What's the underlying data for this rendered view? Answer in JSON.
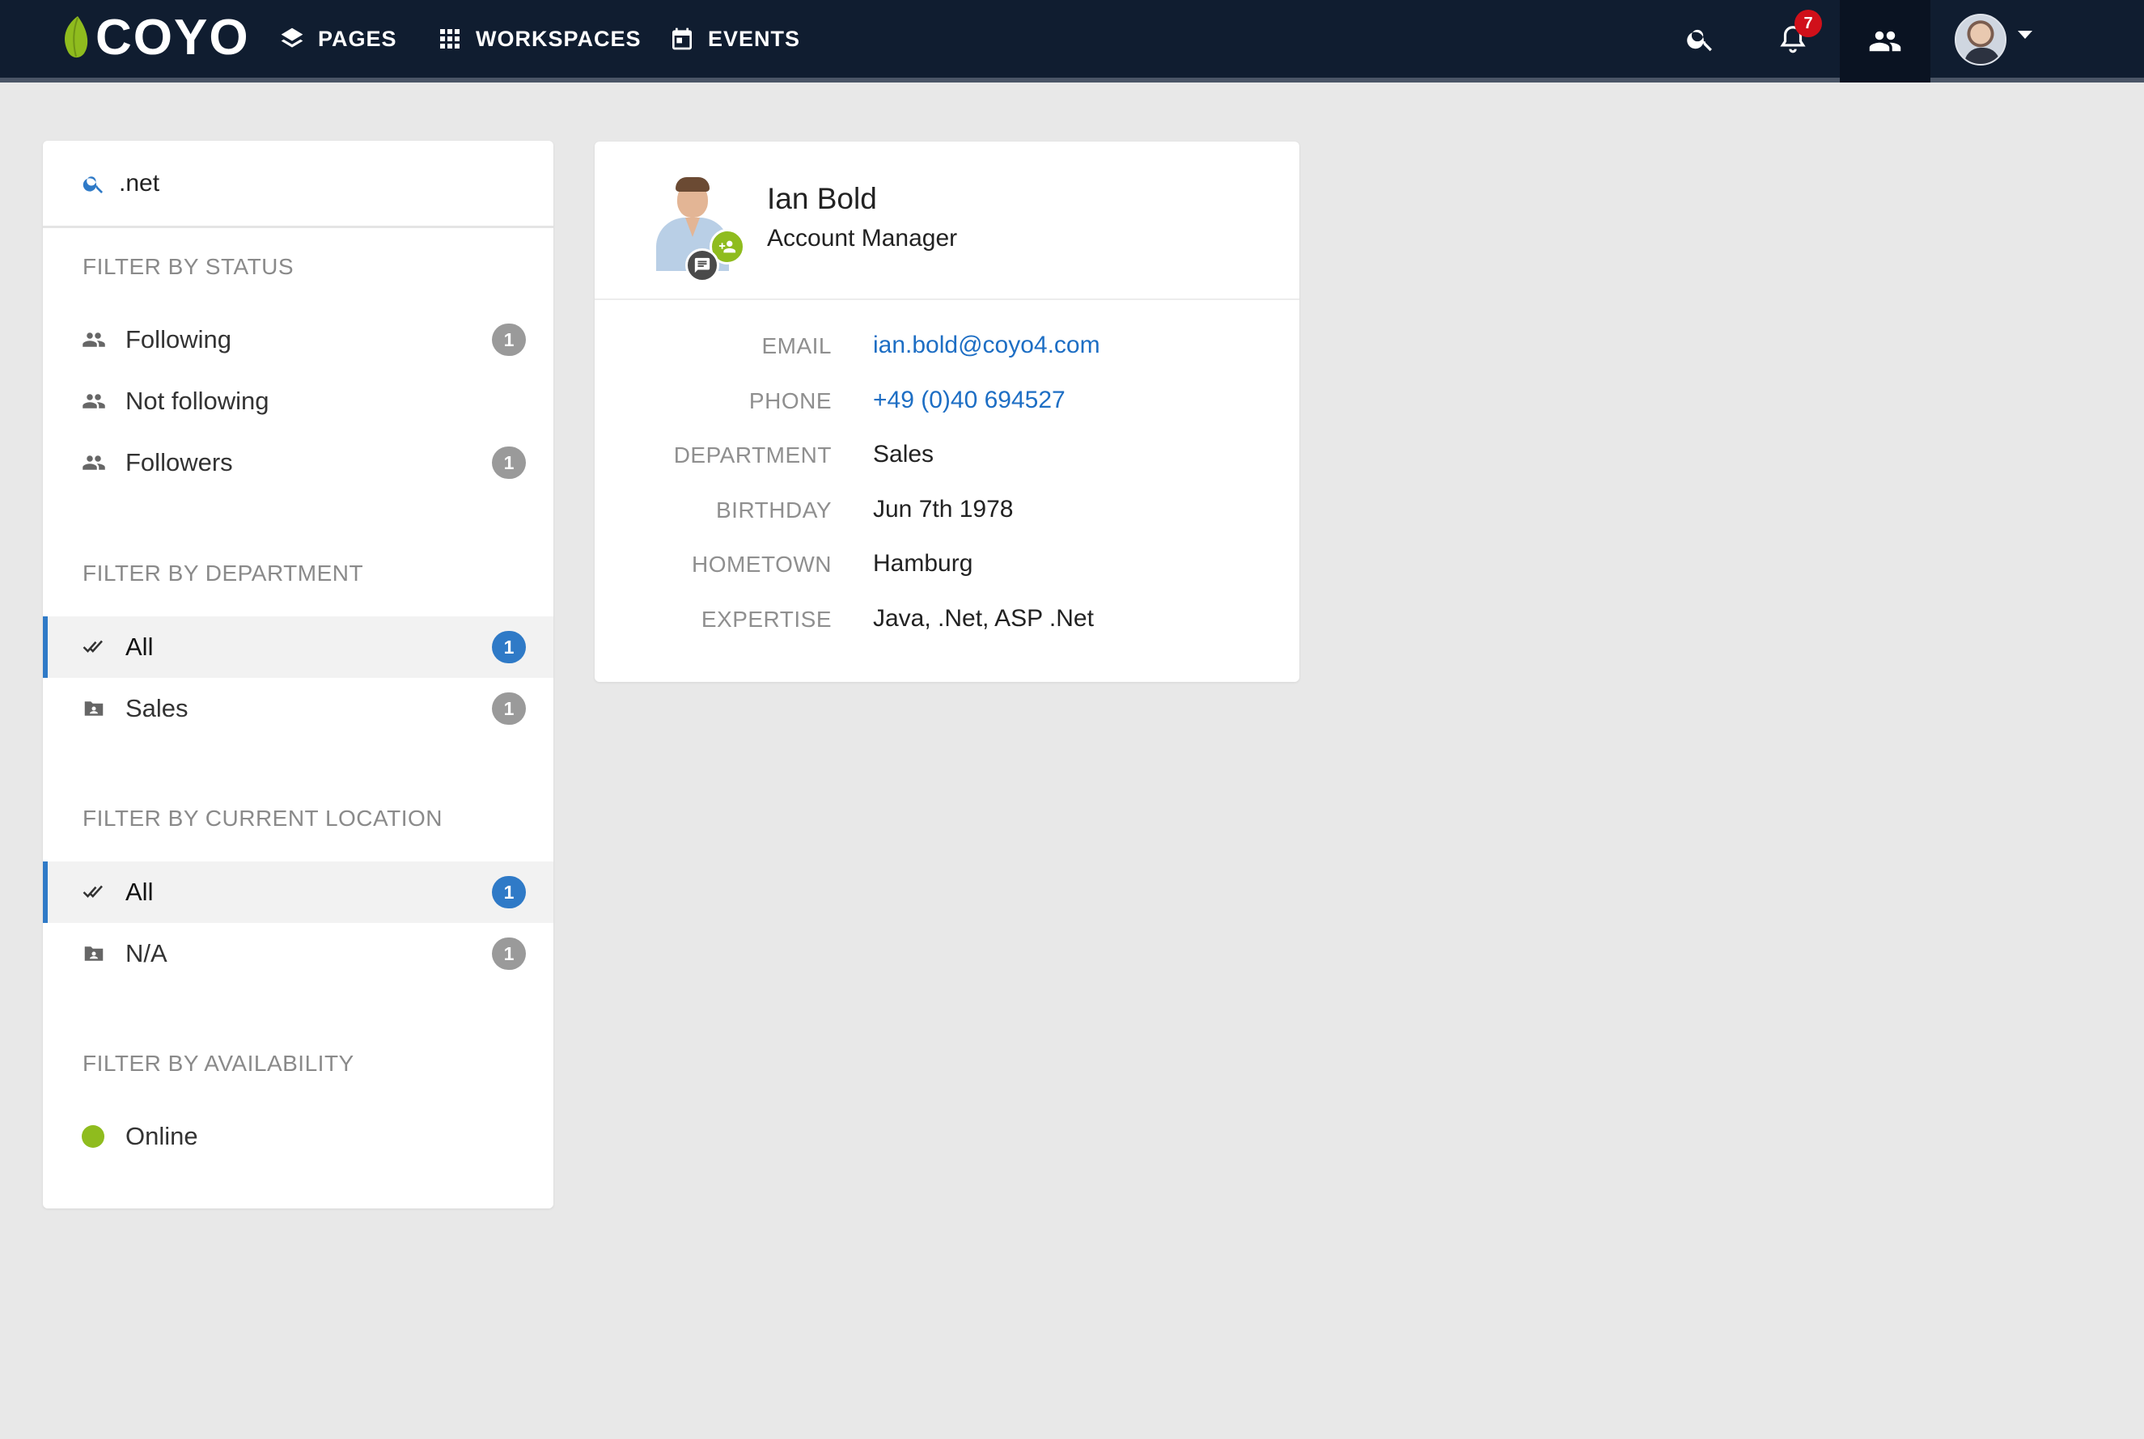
{
  "navbar": {
    "logo_text": "COYO",
    "items": [
      {
        "label": "PAGES",
        "icon": "layers-icon"
      },
      {
        "label": "WORKSPACES",
        "icon": "grid-icon"
      },
      {
        "label": "EVENTS",
        "icon": "calendar-icon"
      }
    ],
    "notifications_count": "7",
    "colors": {
      "background": "#101d30",
      "logo_accent": "#8fbc1e",
      "badge": "#d0101a"
    }
  },
  "search": {
    "value": ".net",
    "placeholder": "Search"
  },
  "filters": {
    "status": {
      "heading": "FILTER BY STATUS",
      "items": [
        {
          "label": "Following",
          "count": "1"
        },
        {
          "label": "Not following",
          "count": ""
        },
        {
          "label": "Followers",
          "count": "1"
        }
      ]
    },
    "department": {
      "heading": "FILTER BY DEPARTMENT",
      "items": [
        {
          "label": "All",
          "count": "1",
          "active": true
        },
        {
          "label": "Sales",
          "count": "1"
        }
      ]
    },
    "location": {
      "heading": "FILTER BY CURRENT LOCATION",
      "items": [
        {
          "label": "All",
          "count": "1",
          "active": true
        },
        {
          "label": "N/A",
          "count": "1"
        }
      ]
    },
    "availability": {
      "heading": "FILTER BY AVAILABILITY",
      "items": [
        {
          "label": "Online",
          "color": "#8fbc1e"
        }
      ]
    }
  },
  "profile": {
    "name": "Ian Bold",
    "job_title": "Account Manager",
    "details": [
      {
        "label": "EMAIL",
        "value": "ian.bold@coyo4.com",
        "link": true
      },
      {
        "label": "PHONE",
        "value": "+49 (0)40 694527",
        "link": true
      },
      {
        "label": "DEPARTMENT",
        "value": "Sales"
      },
      {
        "label": "BIRTHDAY",
        "value": "Jun 7th 1978"
      },
      {
        "label": "HOMETOWN",
        "value": "Hamburg"
      },
      {
        "label": "EXPERTISE",
        "value": "Java, .Net, ASP .Net"
      }
    ]
  }
}
